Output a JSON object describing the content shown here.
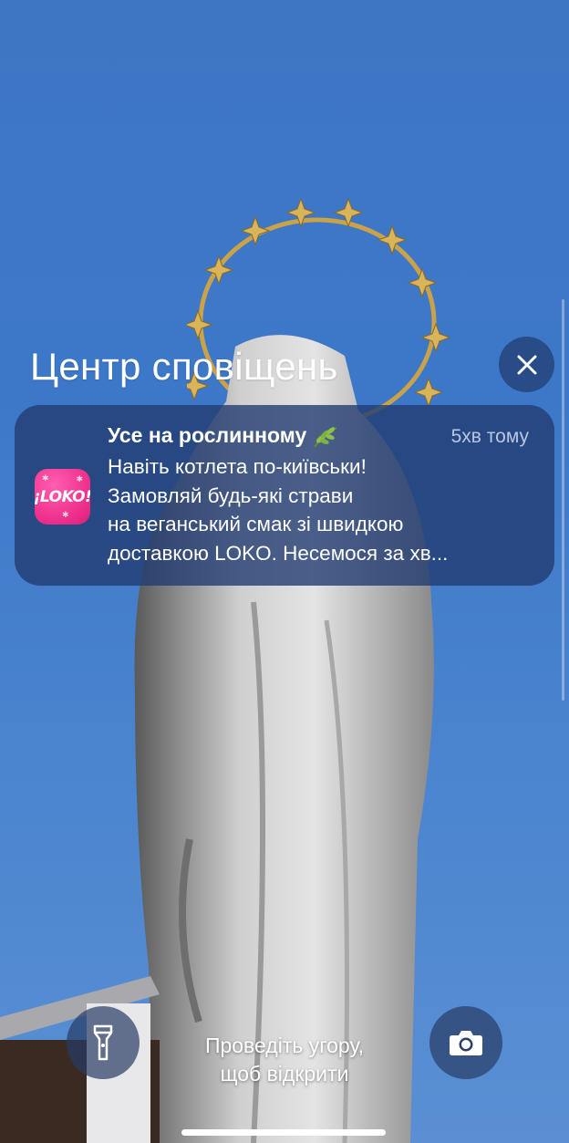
{
  "notification_center": {
    "title": "Центр сповіщень"
  },
  "notification": {
    "app_icon_name": "loko-app-icon",
    "app_logo_text": "¡LOKO!",
    "title": "Усе на рослинному",
    "title_emoji_icon": "herb-leaf-icon",
    "time": "5хв тому",
    "body_lines": [
      "Навіть котлета по-київськи!",
      "Замовляй будь-які страви",
      "на веганський смак зі швидкою",
      "доставкою LOKO. Несемося за хв..."
    ]
  },
  "lock_screen": {
    "swipe_hint_line1": "Проведіть угору,",
    "swipe_hint_line2": "щоб відкрити",
    "left_button_icon": "flashlight-icon",
    "right_button_icon": "camera-icon",
    "close_icon": "close-icon"
  },
  "colors": {
    "sky": "#3f76c4",
    "notification_bg": "#223c70",
    "app_icon_pink": "#f0338f"
  }
}
